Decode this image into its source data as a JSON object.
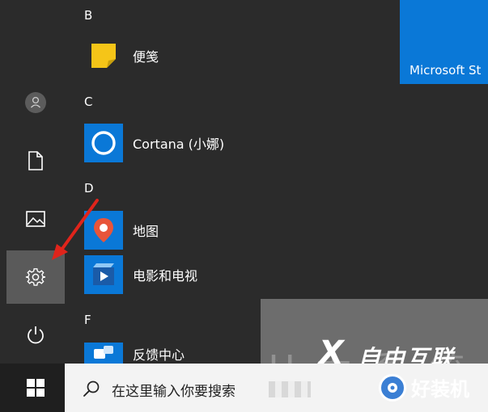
{
  "start_menu": {
    "rail": {
      "user_icon": "user-icon",
      "documents_icon": "document-icon",
      "pictures_icon": "pictures-icon",
      "settings_icon": "gear-icon",
      "power_icon": "power-icon"
    },
    "groups": [
      {
        "letter": "B",
        "apps": [
          {
            "name": "便笺",
            "icon": "sticky-notes-icon",
            "tile_color": "#222222"
          }
        ]
      },
      {
        "letter": "C",
        "apps": [
          {
            "name": "Cortana (小娜)",
            "icon": "cortana-icon",
            "tile_color": "#0a78d7"
          }
        ]
      },
      {
        "letter": "D",
        "apps": [
          {
            "name": "地图",
            "icon": "maps-icon",
            "tile_color": "#0a78d7"
          },
          {
            "name": "电影和电视",
            "icon": "movies-tv-icon",
            "tile_color": "#0a78d7"
          }
        ]
      },
      {
        "letter": "F",
        "apps": [
          {
            "name": "反馈中心",
            "icon": "feedback-hub-icon",
            "tile_color": "#0a78d7"
          }
        ]
      }
    ],
    "pinned_tile": {
      "label": "Microsoft St",
      "color": "#0a78d7"
    }
  },
  "taskbar": {
    "start_icon": "windows-logo-icon",
    "search": {
      "placeholder": "在这里输入你要搜索",
      "icon": "search-icon"
    }
  },
  "annotation": {
    "arrow_color": "#e0241b",
    "points_to": "settings"
  },
  "watermark": {
    "brand": "自由互联",
    "secondary": "好装机",
    "faint_text": "U 大 系 统"
  }
}
